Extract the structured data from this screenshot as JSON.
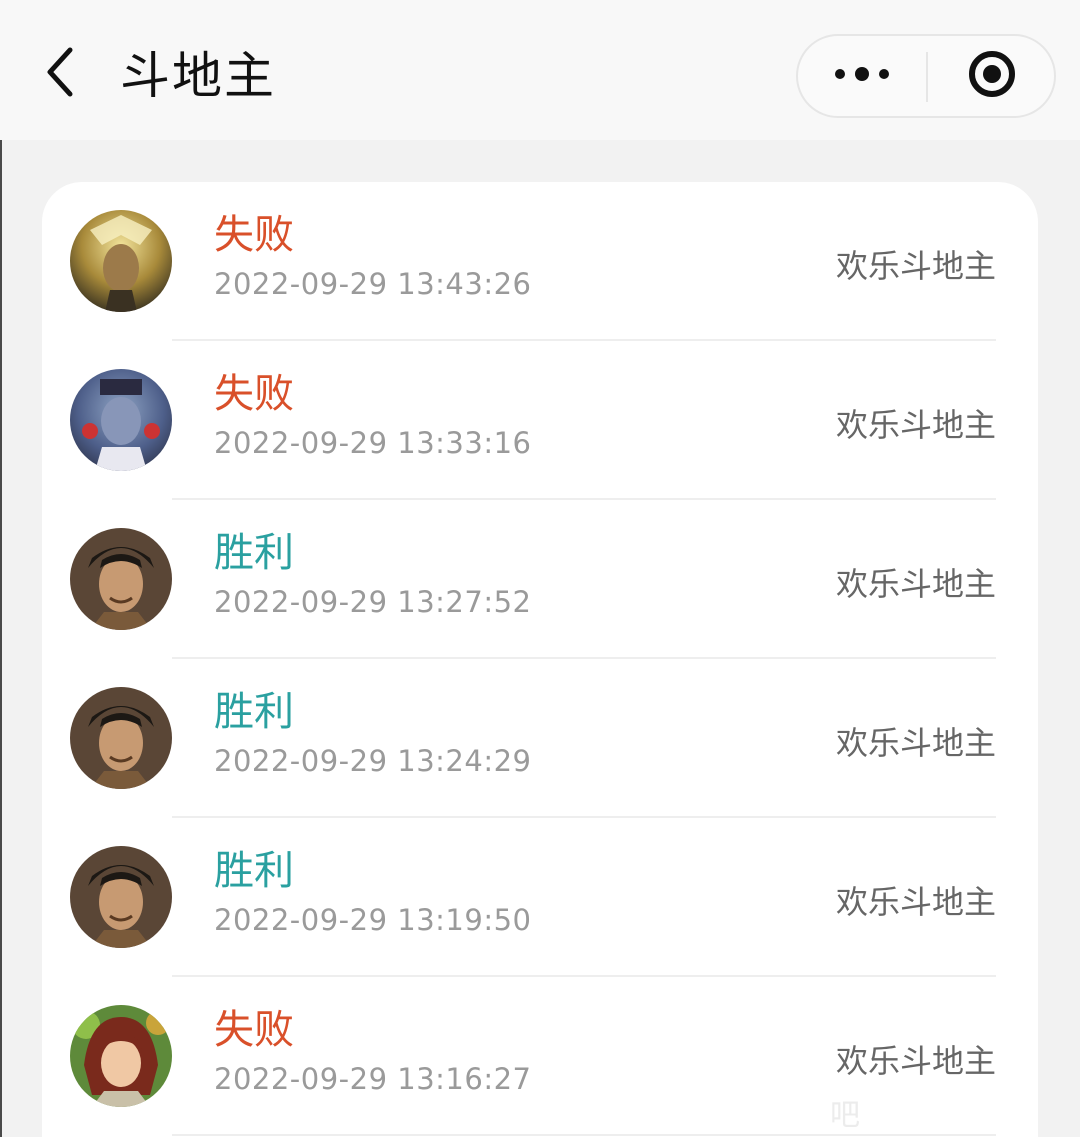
{
  "nav": {
    "title": "斗地主",
    "back_icon": "chevron-left-icon",
    "more_icon": "more-dots-icon",
    "close_icon": "target-close-icon"
  },
  "colors": {
    "lose": "#d9502a",
    "win": "#2aa0a0",
    "time": "#9a9a9a",
    "game": "#666666"
  },
  "records": [
    {
      "result": "失败",
      "time": "2022-09-29 13:43:26",
      "game": "欢乐斗地主",
      "outcome": "lose",
      "avatar": "golden-warrior-avatar"
    },
    {
      "result": "失败",
      "time": "2022-09-29 13:33:16",
      "game": "欢乐斗地主",
      "outcome": "lose",
      "avatar": "masked-general-avatar"
    },
    {
      "result": "胜利",
      "time": "2022-09-29 13:27:52",
      "game": "欢乐斗地主",
      "outcome": "win",
      "avatar": "smiling-scholar-avatar"
    },
    {
      "result": "胜利",
      "time": "2022-09-29 13:24:29",
      "game": "欢乐斗地主",
      "outcome": "win",
      "avatar": "smiling-scholar-avatar"
    },
    {
      "result": "胜利",
      "time": "2022-09-29 13:19:50",
      "game": "欢乐斗地主",
      "outcome": "win",
      "avatar": "smiling-scholar-avatar"
    },
    {
      "result": "失败",
      "time": "2022-09-29 13:16:27",
      "game": "欢乐斗地主",
      "outcome": "lose",
      "avatar": "forest-girl-avatar"
    }
  ],
  "watermark": "吧"
}
